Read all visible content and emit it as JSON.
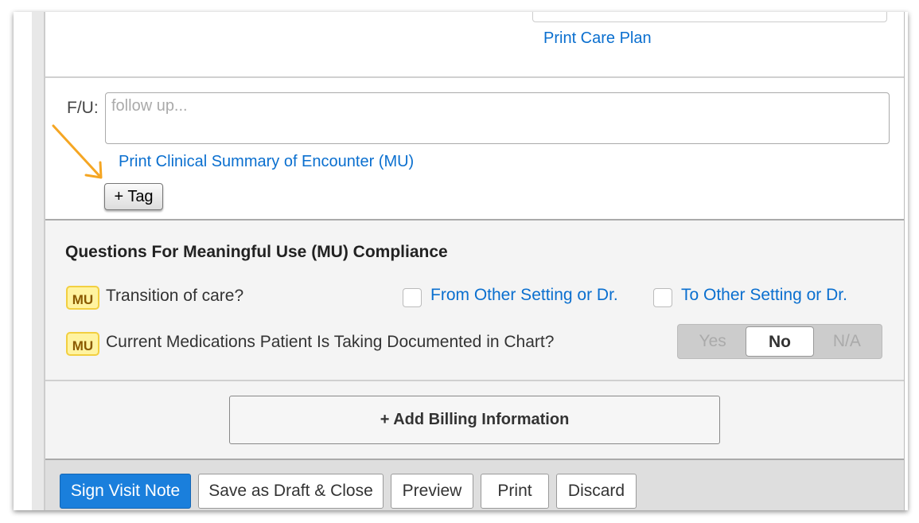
{
  "top": {
    "print_care_plan": "Print Care Plan"
  },
  "followup": {
    "label": "F/U:",
    "placeholder": "follow up...",
    "value": "",
    "print_summary_link": "Print Clinical Summary of Encounter (MU)",
    "tag_button": "+ Tag"
  },
  "mu_section": {
    "title": "Questions For Meaningful Use (MU) Compliance",
    "badge": "MU",
    "transition_question": "Transition of care?",
    "from_option": "From Other Setting or Dr.",
    "to_option": "To Other Setting or Dr.",
    "meds_question": "Current Medications Patient Is Taking Documented in Chart?",
    "meds_options": [
      "Yes",
      "No",
      "N/A"
    ],
    "meds_selected": "No"
  },
  "billing": {
    "add_label": "+ Add Billing Information"
  },
  "footer": {
    "sign": "Sign Visit Note",
    "save_draft": "Save as Draft & Close",
    "preview": "Preview",
    "print": "Print",
    "discard": "Discard"
  },
  "colors": {
    "link": "#0a6fcf",
    "primary": "#1a7fdc",
    "annotation_arrow": "#f5a623",
    "mu_badge": "#fff3a0"
  }
}
